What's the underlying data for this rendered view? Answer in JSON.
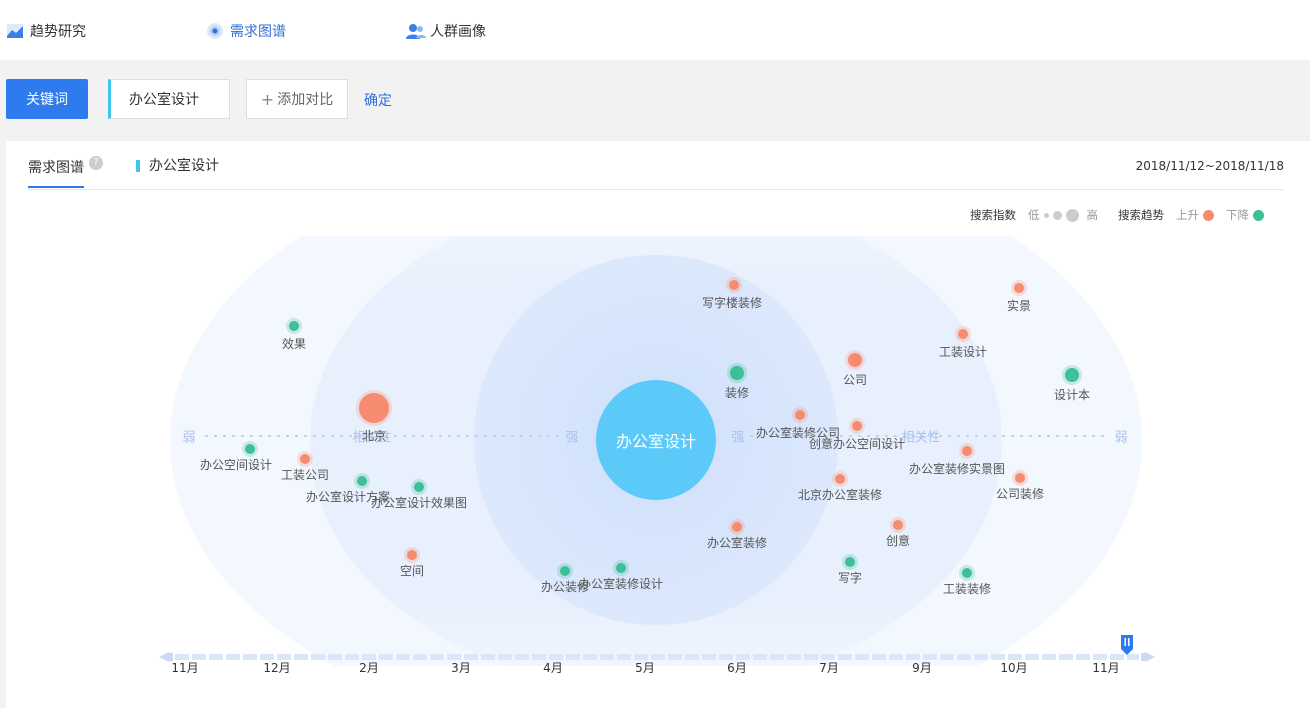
{
  "nav": {
    "tabs": [
      {
        "label": "趋势研究",
        "icon": "trend-chart-icon"
      },
      {
        "label": "需求图谱",
        "icon": "target-radar-icon"
      },
      {
        "label": "人群画像",
        "icon": "people-icon"
      }
    ],
    "active": 1
  },
  "toolbar": {
    "keyword_button": "关键词",
    "keyword_value": "办公室设计",
    "add_compare": "添加对比",
    "confirm": "确定"
  },
  "panel": {
    "title": "需求图谱",
    "help_symbol": "?",
    "keyword": "办公室设计",
    "date_range": "2018/11/12~2018/11/18"
  },
  "legend": {
    "index_label": "搜索指数",
    "low": "低",
    "high": "高",
    "trend_label": "搜索趋势",
    "up": "上升",
    "down": "下降",
    "up_color": "#f78b71",
    "down_color": "#3dbf98"
  },
  "map": {
    "center": "办公室设计",
    "axis_labels": {
      "weak": "弱",
      "relevance": "相关性",
      "strong": "强"
    },
    "nodes": [
      {
        "label": "写字楼装修",
        "trend": "up",
        "size": "small"
      },
      {
        "label": "实景",
        "trend": "up",
        "size": "small"
      },
      {
        "label": "效果",
        "trend": "down",
        "size": "small"
      },
      {
        "label": "工装设计",
        "trend": "up",
        "size": "small"
      },
      {
        "label": "公司",
        "trend": "up",
        "size": "medium"
      },
      {
        "label": "装修",
        "trend": "down",
        "size": "medium"
      },
      {
        "label": "设计本",
        "trend": "down",
        "size": "medium"
      },
      {
        "label": "北京",
        "trend": "up",
        "size": "large"
      },
      {
        "label": "办公室装修公司",
        "trend": "up",
        "size": "small"
      },
      {
        "label": "创意办公空间设计",
        "trend": "up",
        "size": "small"
      },
      {
        "label": "办公空间设计",
        "trend": "down",
        "size": "small"
      },
      {
        "label": "工装公司",
        "trend": "up",
        "size": "small"
      },
      {
        "label": "办公室装修实景图",
        "trend": "up",
        "size": "small"
      },
      {
        "label": "公司装修",
        "trend": "up",
        "size": "small"
      },
      {
        "label": "办公室设计方案",
        "trend": "down",
        "size": "small"
      },
      {
        "label": "办公室设计效果图",
        "trend": "down",
        "size": "small"
      },
      {
        "label": "北京办公室装修",
        "trend": "up",
        "size": "small"
      },
      {
        "label": "创意",
        "trend": "up",
        "size": "small"
      },
      {
        "label": "办公室装修",
        "trend": "up",
        "size": "small"
      },
      {
        "label": "空间",
        "trend": "up",
        "size": "small"
      },
      {
        "label": "写字",
        "trend": "down",
        "size": "small"
      },
      {
        "label": "办公装修",
        "trend": "down",
        "size": "small"
      },
      {
        "label": "办公室装修设计",
        "trend": "down",
        "size": "small"
      },
      {
        "label": "工装装修",
        "trend": "down",
        "size": "small"
      }
    ]
  },
  "timeline": {
    "months": [
      "11月",
      "12月",
      "2月",
      "3月",
      "4月",
      "5月",
      "6月",
      "7月",
      "9月",
      "10月",
      "11月"
    ],
    "selected_index": 10
  }
}
